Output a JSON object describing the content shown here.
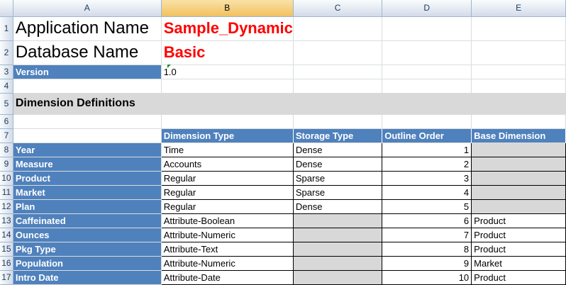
{
  "columns": [
    "A",
    "B",
    "C",
    "D",
    "E"
  ],
  "selected_column": "B",
  "rows": [
    "1",
    "2",
    "3",
    "4",
    "5",
    "6",
    "7",
    "8",
    "9",
    "10",
    "11",
    "12",
    "13",
    "14",
    "15",
    "16",
    "17"
  ],
  "app_label": "Application Name",
  "app_value": "Sample_Dynamic",
  "db_label": "Database Name",
  "db_value": "Basic",
  "version_label": "Version",
  "version_value": "1.0",
  "section_title": "Dimension Definitions",
  "table_headers": [
    "Dimension Type",
    "Storage Type",
    "Outline Order",
    "Base Dimension"
  ],
  "dimensions": [
    {
      "name": "Year",
      "type": "Time",
      "storage": "Dense",
      "order": "1",
      "base": ""
    },
    {
      "name": "Measure",
      "type": "Accounts",
      "storage": "Dense",
      "order": "2",
      "base": ""
    },
    {
      "name": "Product",
      "type": "Regular",
      "storage": "Sparse",
      "order": "3",
      "base": ""
    },
    {
      "name": "Market",
      "type": "Regular",
      "storage": "Sparse",
      "order": "4",
      "base": ""
    },
    {
      "name": "Plan",
      "type": "Regular",
      "storage": "Dense",
      "order": "5",
      "base": ""
    },
    {
      "name": "Caffeinated",
      "type": "Attribute-Boolean",
      "storage": "",
      "order": "6",
      "base": "Product"
    },
    {
      "name": "Ounces",
      "type": "Attribute-Numeric",
      "storage": "",
      "order": "7",
      "base": "Product"
    },
    {
      "name": "Pkg Type",
      "type": "Attribute-Text",
      "storage": "",
      "order": "8",
      "base": "Product"
    },
    {
      "name": "Population",
      "type": "Attribute-Numeric",
      "storage": "",
      "order": "9",
      "base": "Market"
    },
    {
      "name": "Intro Date",
      "type": "Attribute-Date",
      "storage": "",
      "order": "10",
      "base": "Product"
    }
  ]
}
